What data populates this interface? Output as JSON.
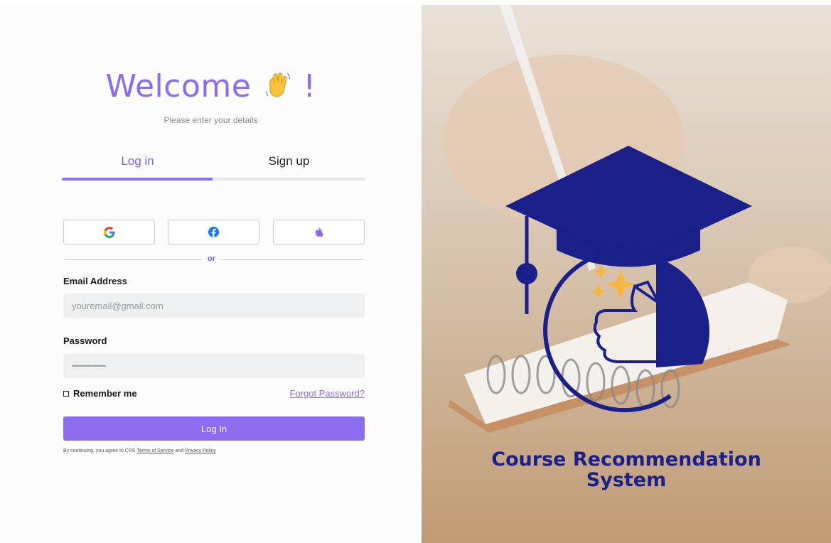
{
  "login": {
    "title": "Welcome",
    "title_suffix": "!",
    "subtitle": "Please enter your details",
    "tabs": [
      {
        "label": "Log in",
        "active": true
      },
      {
        "label": "Sign up",
        "active": false
      }
    ],
    "social": [
      {
        "icon": "google-icon"
      },
      {
        "icon": "facebook-icon"
      },
      {
        "icon": "apple-icon"
      }
    ],
    "divider_text": "or",
    "email": {
      "label": "Email Address",
      "placeholder": "youremail@gmail.com"
    },
    "password": {
      "label": "Password",
      "value": "••••••••••••••••••••••"
    },
    "remember_label": "Remember me",
    "forgot_label": "Forgot Password?",
    "submit_label": "Log In",
    "legal": {
      "prefix": "By continuing, you agree to CRS ",
      "terms": "Terms of Service",
      "and": " and ",
      "privacy": "Privacy Policy"
    }
  },
  "brand": {
    "title_line1": "Course Recommendation",
    "title_line2": "System"
  },
  "colors": {
    "accent": "#8b6cef",
    "brand_navy": "#1b1f8a",
    "star": "#f6b53d"
  }
}
